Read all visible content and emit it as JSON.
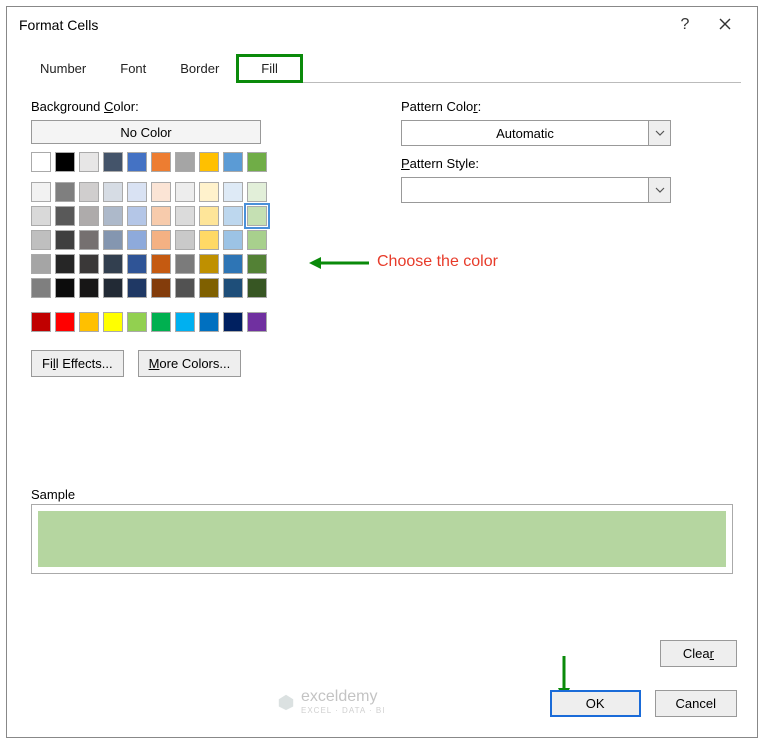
{
  "dialog": {
    "title": "Format Cells",
    "help": "?"
  },
  "tabs": {
    "number": "Number",
    "font": "Font",
    "border": "Border",
    "fill": "Fill"
  },
  "labels": {
    "bg_pre": "Background ",
    "bg_u": "C",
    "bg_post": "olor:",
    "pc_pre": "Pattern Colo",
    "pc_u": "r",
    "pc_post": ":",
    "ps_pre": "",
    "ps_u": "P",
    "ps_post": "attern Style:",
    "sample": "Sample"
  },
  "buttons": {
    "no_color": "No Color",
    "fe_pre": "Fi",
    "fe_u": "l",
    "fe_post": "l Effects...",
    "mc_pre": "",
    "mc_u": "M",
    "mc_post": "ore Colors...",
    "clear_pre": "Clea",
    "clear_u": "r",
    "clear_post": "",
    "ok": "OK",
    "cancel": "Cancel"
  },
  "combos": {
    "pattern_color": "Automatic",
    "pattern_style": ""
  },
  "annotation": {
    "text": "Choose the color"
  },
  "watermark": {
    "brand": "exceldemy",
    "sub": "EXCEL · DATA · BI"
  },
  "colors": {
    "theme_row": [
      "#ffffff",
      "#000000",
      "#44546a",
      "#4472c4",
      "#5b9bd5",
      "#ed7d31",
      "#a5a5a5",
      "#ffc000",
      "#70ad47",
      "#70ad47"
    ],
    "theme_row_alt": [
      "#ffffff",
      "#000000",
      "#e7e6e6",
      "#44546a",
      "#4472c4",
      "#ed7d31",
      "#a5a5a5",
      "#ffc000",
      "#5b9bd5",
      "#70ad47"
    ],
    "shades": [
      [
        "#f2f2f2",
        "#7f7f7f",
        "#d0cece",
        "#d6dce4",
        "#d9e2f3",
        "#fbe4d5",
        "#ededed",
        "#fff2cc",
        "#deeaf6",
        "#e2efd9"
      ],
      [
        "#d9d9d9",
        "#595959",
        "#aeabab",
        "#adb9ca",
        "#b4c6e7",
        "#f7cbac",
        "#dbdbdb",
        "#fee599",
        "#bdd7ee",
        "#c5e0b3"
      ],
      [
        "#bfbfbf",
        "#3f3f3f",
        "#757070",
        "#8496b0",
        "#8eaadb",
        "#f4b183",
        "#c9c9c9",
        "#ffd965",
        "#9cc3e5",
        "#a8d08d"
      ],
      [
        "#a5a5a5",
        "#262626",
        "#3a3838",
        "#323f4f",
        "#2f5496",
        "#c55a11",
        "#7b7b7b",
        "#bf9000",
        "#2e75b5",
        "#538135"
      ],
      [
        "#7f7f7f",
        "#0c0c0c",
        "#171616",
        "#222a35",
        "#1f3864",
        "#833c0b",
        "#525252",
        "#7f6000",
        "#1e4e79",
        "#375623"
      ]
    ],
    "standard": [
      "#c00000",
      "#ff0000",
      "#ffc000",
      "#ffff00",
      "#92d050",
      "#00b050",
      "#00b0f0",
      "#0070c0",
      "#002060",
      "#7030a0"
    ],
    "selected": "#c5e0b3",
    "sample_fill": "#b5d6a0"
  }
}
